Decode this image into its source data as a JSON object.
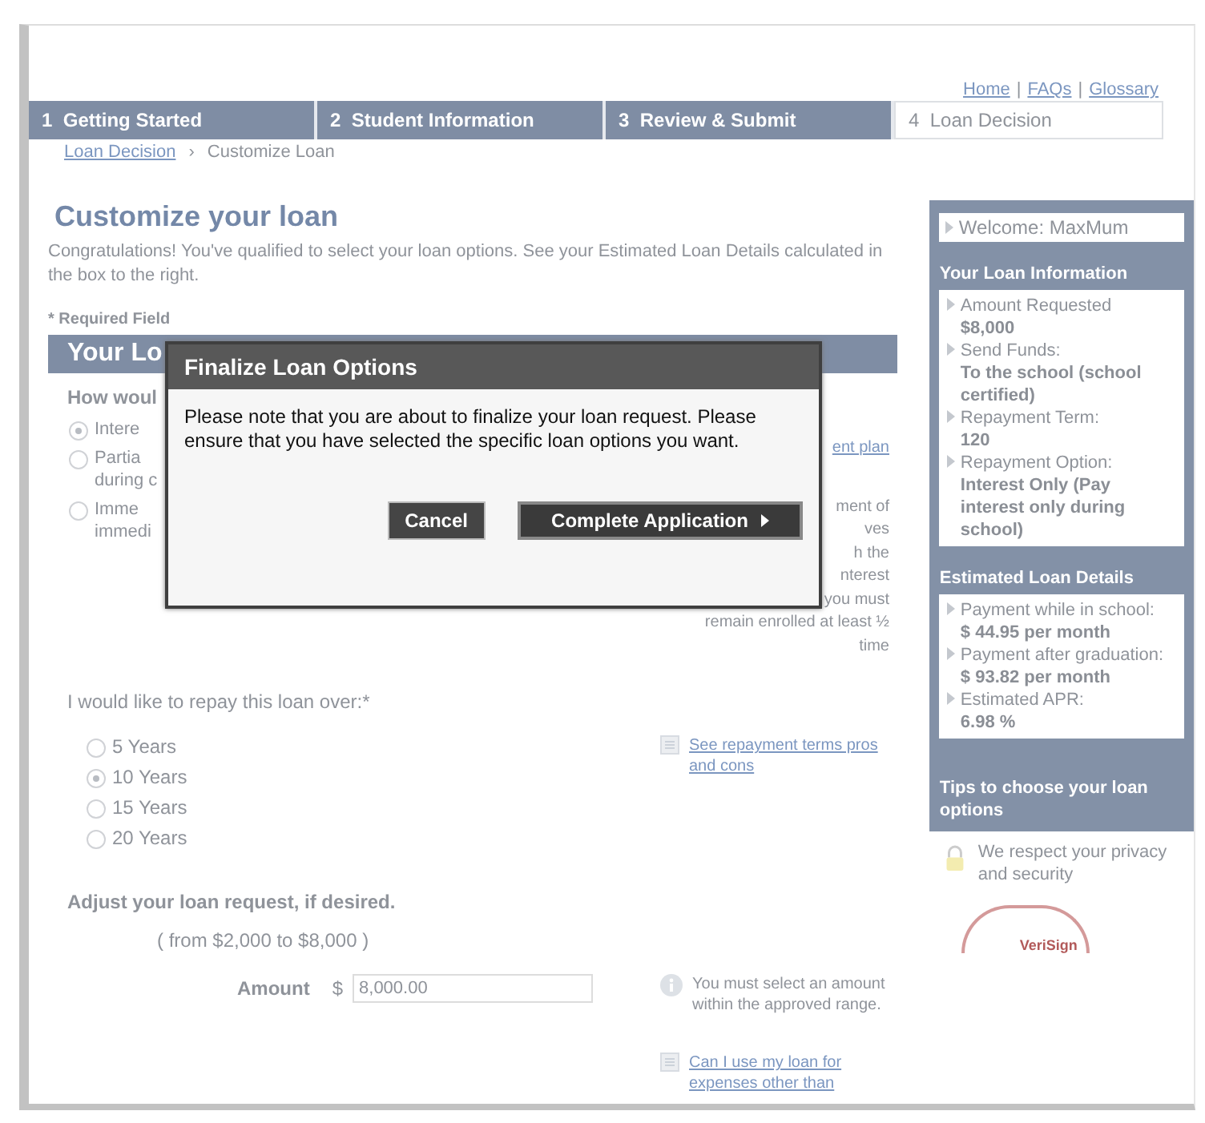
{
  "header_links": {
    "separator": "|",
    "items": [
      {
        "label": "Home"
      },
      {
        "label": "FAQs"
      },
      {
        "label": "Glossary"
      }
    ]
  },
  "steps": [
    {
      "number": "1",
      "label": "Getting Started",
      "selected": false
    },
    {
      "number": "2",
      "label": "Student Information",
      "selected": false
    },
    {
      "number": "3",
      "label": "Review & Submit",
      "selected": false
    },
    {
      "number": "4",
      "label": "Loan Decision",
      "selected": true
    }
  ],
  "breadcrumb": {
    "link": "Loan Decision",
    "separator": "›",
    "current": "Customize Loan"
  },
  "page": {
    "title": "Customize your loan",
    "intro": "Congratulations! You've qualified to select your loan options. See your Estimated Loan Details calculated in the box to the right.",
    "required_note": "* Required Field"
  },
  "section": {
    "title": "Your Lo",
    "question": "How woul",
    "options": [
      {
        "lines": [
          "Intere"
        ],
        "selected": true
      },
      {
        "lines": [
          "Partia",
          "during c"
        ],
        "selected": false
      },
      {
        "lines": [
          "Imme",
          "immedi"
        ],
        "selected": false
      }
    ],
    "side_link": "ent plan",
    "side_note_lines": [
      "ment of",
      "ves",
      "h the",
      "nterest",
      "you must",
      "remain enrolled at least ½",
      "time"
    ]
  },
  "repay": {
    "question": "I would like to repay this loan over:*",
    "options": [
      {
        "label": "5 Years",
        "selected": false
      },
      {
        "label": "10 Years",
        "selected": true
      },
      {
        "label": "15 Years",
        "selected": false
      },
      {
        "label": "20 Years",
        "selected": false
      }
    ],
    "link": "See repayment terms pros and cons"
  },
  "adjust": {
    "title": "Adjust your loan request, if desired.",
    "range": "( from $2,000 to $8,000 )",
    "amount_label": "Amount",
    "currency": "$",
    "amount_value": "8,000.00",
    "note": "You must select an amount within the approved range.",
    "link": "Can I use my loan for expenses other than"
  },
  "sidebar": {
    "welcome": "Welcome: MaxMum",
    "sections": [
      {
        "title": "Your Loan Information",
        "items": [
          {
            "label": "Amount Requested",
            "value": "$8,000"
          },
          {
            "label": "Send Funds:",
            "value": "To the school (school certified)"
          },
          {
            "label": "Repayment Term:",
            "value": "120"
          },
          {
            "label": "Repayment Option:",
            "value": "Interest Only (Pay interest only during school)"
          }
        ]
      },
      {
        "title": "Estimated Loan Details",
        "items": [
          {
            "label": "Payment while in school:",
            "value": "$ 44.95 per month"
          },
          {
            "label": "Payment after graduation:",
            "value": "$ 93.82 per month"
          },
          {
            "label": "Estimated APR:",
            "value": "6.98 %"
          }
        ]
      }
    ],
    "tips": "Tips to choose your loan options",
    "privacy": "We respect your privacy and security",
    "seal": "VeriSign"
  },
  "dialog": {
    "title": "Finalize Loan Options",
    "message": "Please note that you are about to finalize your loan request. Please ensure that you have selected the specific loan options you want.",
    "buttons": [
      {
        "label": "Cancel",
        "kind": "secondary"
      },
      {
        "label": "Complete Application",
        "kind": "primary"
      }
    ]
  }
}
